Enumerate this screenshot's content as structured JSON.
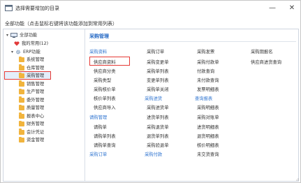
{
  "window": {
    "title": "选择需要增加的目录"
  },
  "hint": "全部功能（点击鼠标右键将该功能添加到常用列表）",
  "tree": {
    "root": "全部功能",
    "favorites": "我的常用(12)",
    "erp": "ERP功能",
    "modules": [
      "系统管理",
      "仓库管理",
      "采购管理",
      "销售管理",
      "生产管理",
      "委外管理",
      "质量管理",
      "报表中心",
      "财务管理",
      "会计凭证",
      "资金管理"
    ],
    "selected_index": 2
  },
  "right": {
    "title": "采购管理",
    "col1": [
      {
        "type": "section",
        "text": "采购资料"
      },
      {
        "type": "item",
        "text": "供应商资料",
        "highlighted": true
      },
      {
        "type": "item",
        "text": "供应商分类"
      },
      {
        "type": "item",
        "text": "采购类型"
      },
      {
        "type": "item",
        "text": "采购核价单"
      },
      {
        "type": "item",
        "text": "核价单列表"
      },
      {
        "type": "item",
        "text": "供应商导入"
      },
      {
        "type": "section",
        "text": "请购管理"
      },
      {
        "type": "item",
        "text": "请购单"
      },
      {
        "type": "item",
        "text": "请购单列表"
      },
      {
        "type": "item",
        "text": "请购单查询"
      },
      {
        "type": "section",
        "text": "采购订单"
      }
    ],
    "col2": [
      {
        "type": "item",
        "text": "采购订单"
      },
      {
        "type": "item",
        "text": "采购变更单"
      },
      {
        "type": "item",
        "text": "采购单列表"
      },
      {
        "type": "item",
        "text": "变更单列表"
      },
      {
        "type": "item",
        "text": "采购单关闭"
      },
      {
        "type": "section",
        "text": "采购进货"
      },
      {
        "type": "item",
        "text": "采购进货单"
      },
      {
        "type": "item",
        "text": "进货单列表"
      },
      {
        "type": "item",
        "text": "采购退货单"
      },
      {
        "type": "item",
        "text": "退货单列表"
      },
      {
        "type": "item",
        "text": "采购验退单"
      },
      {
        "type": "section",
        "text": "采购付款"
      }
    ],
    "col3": [
      {
        "type": "item",
        "text": "采购发票"
      },
      {
        "type": "item",
        "text": "采购付款单"
      },
      {
        "type": "item",
        "text": "付款查询"
      },
      {
        "type": "item",
        "text": "未付款查询"
      },
      {
        "type": "item",
        "text": "发票明细表"
      },
      {
        "type": "section",
        "text": "查询报表"
      },
      {
        "type": "item",
        "text": "采购明细表"
      },
      {
        "type": "item",
        "text": "采购对账单"
      },
      {
        "type": "item",
        "text": "进货明细表"
      },
      {
        "type": "item",
        "text": "退货明细表"
      },
      {
        "type": "item",
        "text": "核价明细表"
      },
      {
        "type": "item",
        "text": "未交货查询"
      }
    ],
    "col4": [
      {
        "type": "item",
        "text": "采购期报名"
      },
      {
        "type": "item",
        "text": "供应商进货查询"
      }
    ]
  },
  "colors": {
    "accent": "#2f74d0",
    "highlight_border": "#e53935",
    "selected_bg": "#e4eefb",
    "folder": "#f1b43d"
  }
}
